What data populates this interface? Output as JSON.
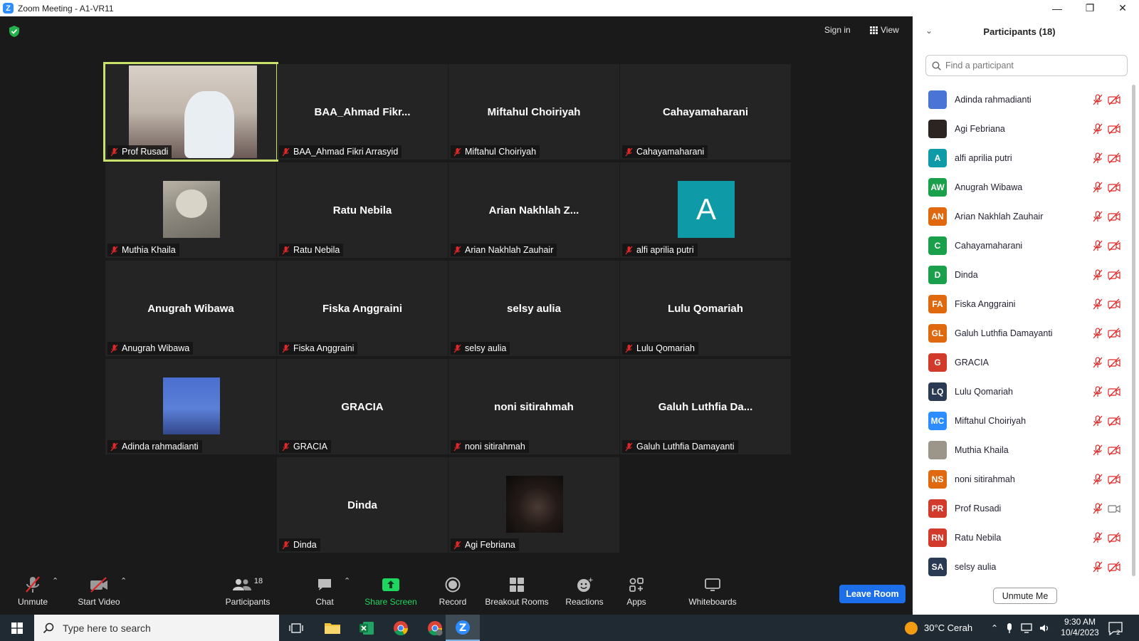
{
  "window": {
    "title": "Zoom Meeting - A1-VR11",
    "minimize": "—",
    "restore": "❐",
    "close": "✕"
  },
  "top_controls": {
    "signin": "Sign in",
    "view": "View"
  },
  "tiles": [
    {
      "name": "Prof Rusadi",
      "big": "",
      "media": "video",
      "active": true
    },
    {
      "name": "BAA_Ahmad Fikri Arrasyid",
      "big": "BAA_Ahmad  Fikr..."
    },
    {
      "name": "Miftahul Choiriyah",
      "big": "Miftahul Choiriyah"
    },
    {
      "name": "Cahayamaharani",
      "big": "Cahayamaharani"
    },
    {
      "name": "Muthia Khaila",
      "big": "",
      "media": "bear"
    },
    {
      "name": "Ratu Nebila",
      "big": "Ratu Nebila"
    },
    {
      "name": "Arian Nakhlah Zauhair",
      "big": "Arian  Nakhlah  Z..."
    },
    {
      "name": "alfi aprilia putri",
      "big": "",
      "media": "letter",
      "letter": "A"
    },
    {
      "name": "Anugrah Wibawa",
      "big": "Anugrah Wibawa"
    },
    {
      "name": "Fiska Anggraini",
      "big": "Fiska Anggraini"
    },
    {
      "name": "selsy aulia",
      "big": "selsy aulia"
    },
    {
      "name": "Lulu  Qomariah",
      "big": "Lulu  Qomariah"
    },
    {
      "name": "Adinda rahmadianti",
      "big": "",
      "media": "sky"
    },
    {
      "name": "GRACIA",
      "big": "GRACIA"
    },
    {
      "name": "noni sitirahmah",
      "big": "noni sitirahmah"
    },
    {
      "name": "Galuh Luthfia Damayanti",
      "big": "Galuh  Luthfia  Da..."
    },
    {
      "name": "Dinda",
      "big": "Dinda"
    },
    {
      "name": "Agi Febriana",
      "big": "",
      "media": "night"
    }
  ],
  "toolbar": {
    "unmute": "Unmute",
    "start_video": "Start Video",
    "participants": "Participants",
    "participants_count": "18",
    "chat": "Chat",
    "share_screen": "Share Screen",
    "record": "Record",
    "breakout_rooms": "Breakout Rooms",
    "reactions": "Reactions",
    "apps": "Apps",
    "whiteboards": "Whiteboards",
    "leave": "Leave Room"
  },
  "panel": {
    "title": "Participants (18)",
    "search_placeholder": "Find a participant",
    "unmute_me": "Unmute Me",
    "participants": [
      {
        "name": "Adinda rahmadianti",
        "initials": "",
        "color": "#4a74d6",
        "video": "off"
      },
      {
        "name": "Agi Febriana",
        "initials": "",
        "color": "#2b2421",
        "video": "off"
      },
      {
        "name": "alfi aprilia putri",
        "initials": "A",
        "color": "#0e9aa7",
        "video": "off"
      },
      {
        "name": "Anugrah Wibawa",
        "initials": "AW",
        "color": "#1aa04a",
        "video": "off"
      },
      {
        "name": "Arian Nakhlah Zauhair",
        "initials": "AN",
        "color": "#e0690f",
        "video": "off"
      },
      {
        "name": "Cahayamaharani",
        "initials": "C",
        "color": "#1aa04a",
        "video": "off"
      },
      {
        "name": "Dinda",
        "initials": "D",
        "color": "#1aa04a",
        "video": "off"
      },
      {
        "name": "Fiska Anggraini",
        "initials": "FA",
        "color": "#e0690f",
        "video": "off"
      },
      {
        "name": "Galuh Luthfia Damayanti",
        "initials": "GL",
        "color": "#e0690f",
        "video": "off"
      },
      {
        "name": "GRACIA",
        "initials": "G",
        "color": "#d23a2c",
        "video": "off"
      },
      {
        "name": "Lulu  Qomariah",
        "initials": "LQ",
        "color": "#2a3a52",
        "video": "off"
      },
      {
        "name": "Miftahul Choiriyah",
        "initials": "MC",
        "color": "#2d8cff",
        "video": "off"
      },
      {
        "name": "Muthia Khaila",
        "initials": "",
        "color": "#9c958a",
        "video": "off"
      },
      {
        "name": "noni sitirahmah",
        "initials": "NS",
        "color": "#e0690f",
        "video": "off"
      },
      {
        "name": "Prof Rusadi",
        "initials": "PR",
        "color": "#d23a2c",
        "video": "on"
      },
      {
        "name": "Ratu Nebila",
        "initials": "RN",
        "color": "#d23a2c",
        "video": "off"
      },
      {
        "name": "selsy aulia",
        "initials": "SA",
        "color": "#2a3a52",
        "video": "off"
      }
    ]
  },
  "taskbar": {
    "search_placeholder": "Type here to search",
    "weather": "30°C  Cerah",
    "time": "9:30 AM",
    "date": "10/4/2023",
    "notif_count": "2"
  }
}
